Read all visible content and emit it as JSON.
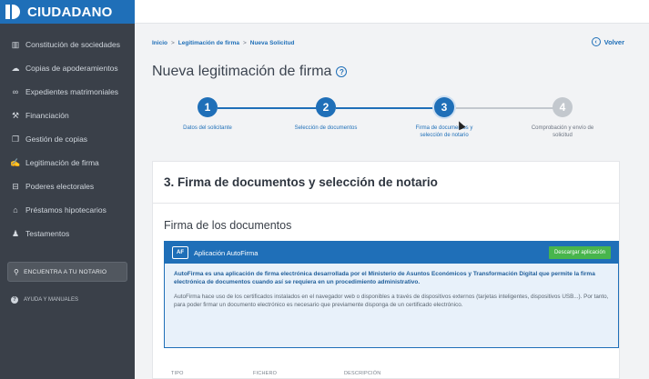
{
  "brand": {
    "title": "CIUDADANO"
  },
  "sidebar": {
    "items": [
      {
        "label": "Constitución de sociedades",
        "icon": "building-icon"
      },
      {
        "label": "Copias de apoderamientos",
        "icon": "cloud-icon"
      },
      {
        "label": "Expedientes matrimoniales",
        "icon": "rings-icon"
      },
      {
        "label": "Financiación",
        "icon": "hammer-icon"
      },
      {
        "label": "Gestión de copias",
        "icon": "copy-icon"
      },
      {
        "label": "Legitimación de firma",
        "icon": "signature-icon"
      },
      {
        "label": "Poderes electorales",
        "icon": "ballot-icon"
      },
      {
        "label": "Préstamos hipotecarios",
        "icon": "house-icon"
      },
      {
        "label": "Testamentos",
        "icon": "people-icon"
      }
    ],
    "notary_button": "ENCUENTRA A TU NOTARIO",
    "help": "AYUDA Y MANUALES"
  },
  "breadcrumb": {
    "items": [
      "Inicio",
      "Legitimación de firma",
      "Nueva Solicitud"
    ]
  },
  "back_label": "Volver",
  "page_title": "Nueva legitimación de firma",
  "stepper": {
    "steps": [
      {
        "number": "1",
        "label": "Datos del solicitante",
        "state": "done"
      },
      {
        "number": "2",
        "label": "Selección de documentos",
        "state": "done"
      },
      {
        "number": "3",
        "label": "Firma de documentos y selección de notario",
        "state": "active"
      },
      {
        "number": "4",
        "label": "Comprobación y envío de solicitud",
        "state": "pending"
      }
    ]
  },
  "card": {
    "header": "3. Firma de documentos y selección de notario",
    "subtitle": "Firma de los documentos"
  },
  "autofirma": {
    "title": "Aplicación AutoFirma",
    "download_label": "Descargar aplicación",
    "bold_text": "AutoFirma es una aplicación de firma electrónica desarrollada por el Ministerio de Asuntos Económicos y Transformación Digital que permite la firma electrónica de documentos cuando así se requiera en un procedimiento administrativo.",
    "text": "AutoFirma hace uso de los certificados instalados en el navegador web o disponibles a través de dispositivos externos (tarjetas inteligentes, dispositivos USB...). Por tanto, para poder firmar un documento electrónico es necesario que previamente disponga de un certificado electrónico."
  },
  "table": {
    "columns": [
      "TIPO",
      "FICHERO",
      "DESCRIPCIÓN"
    ]
  },
  "colors": {
    "sidebar_bg": "#3a4049",
    "brand_blue": "#1f6fb8",
    "download_green": "#48b54c",
    "pending_gray": "#c3c8ce"
  }
}
